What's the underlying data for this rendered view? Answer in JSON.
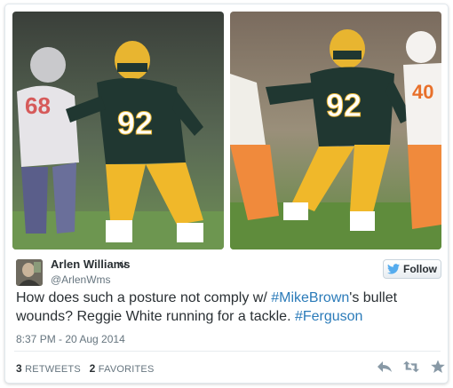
{
  "author": {
    "name": "Arlen Williams",
    "handle": "@ArlenWms",
    "verified_glyph": "ن"
  },
  "follow_button": {
    "label": "Follow",
    "icon": "twitter-bird-icon"
  },
  "tweet": {
    "text_before": "How does such a posture not comply w/ ",
    "hashtag_1": "#MikeBrown",
    "text_middle": "'s bullet wounds? Reggie White running for a tackle. ",
    "hashtag_2": "#Ferguson"
  },
  "timestamp": "8:37 PM - 20 Aug 2014",
  "stats": {
    "retweets_count": "3",
    "retweets_label": "RETWEETS",
    "favorites_count": "2",
    "favorites_label": "FAVORITES"
  },
  "photos": {
    "left_jersey_number": "92",
    "right_jersey_number": "92",
    "left_opponent_number": "68",
    "right_opponent_number": "40"
  },
  "actions": [
    "reply-icon",
    "retweet-icon",
    "favorite-icon"
  ],
  "colors": {
    "link": "#2b7bb9",
    "packers_green": "#203731",
    "packers_gold": "#ffb612"
  }
}
